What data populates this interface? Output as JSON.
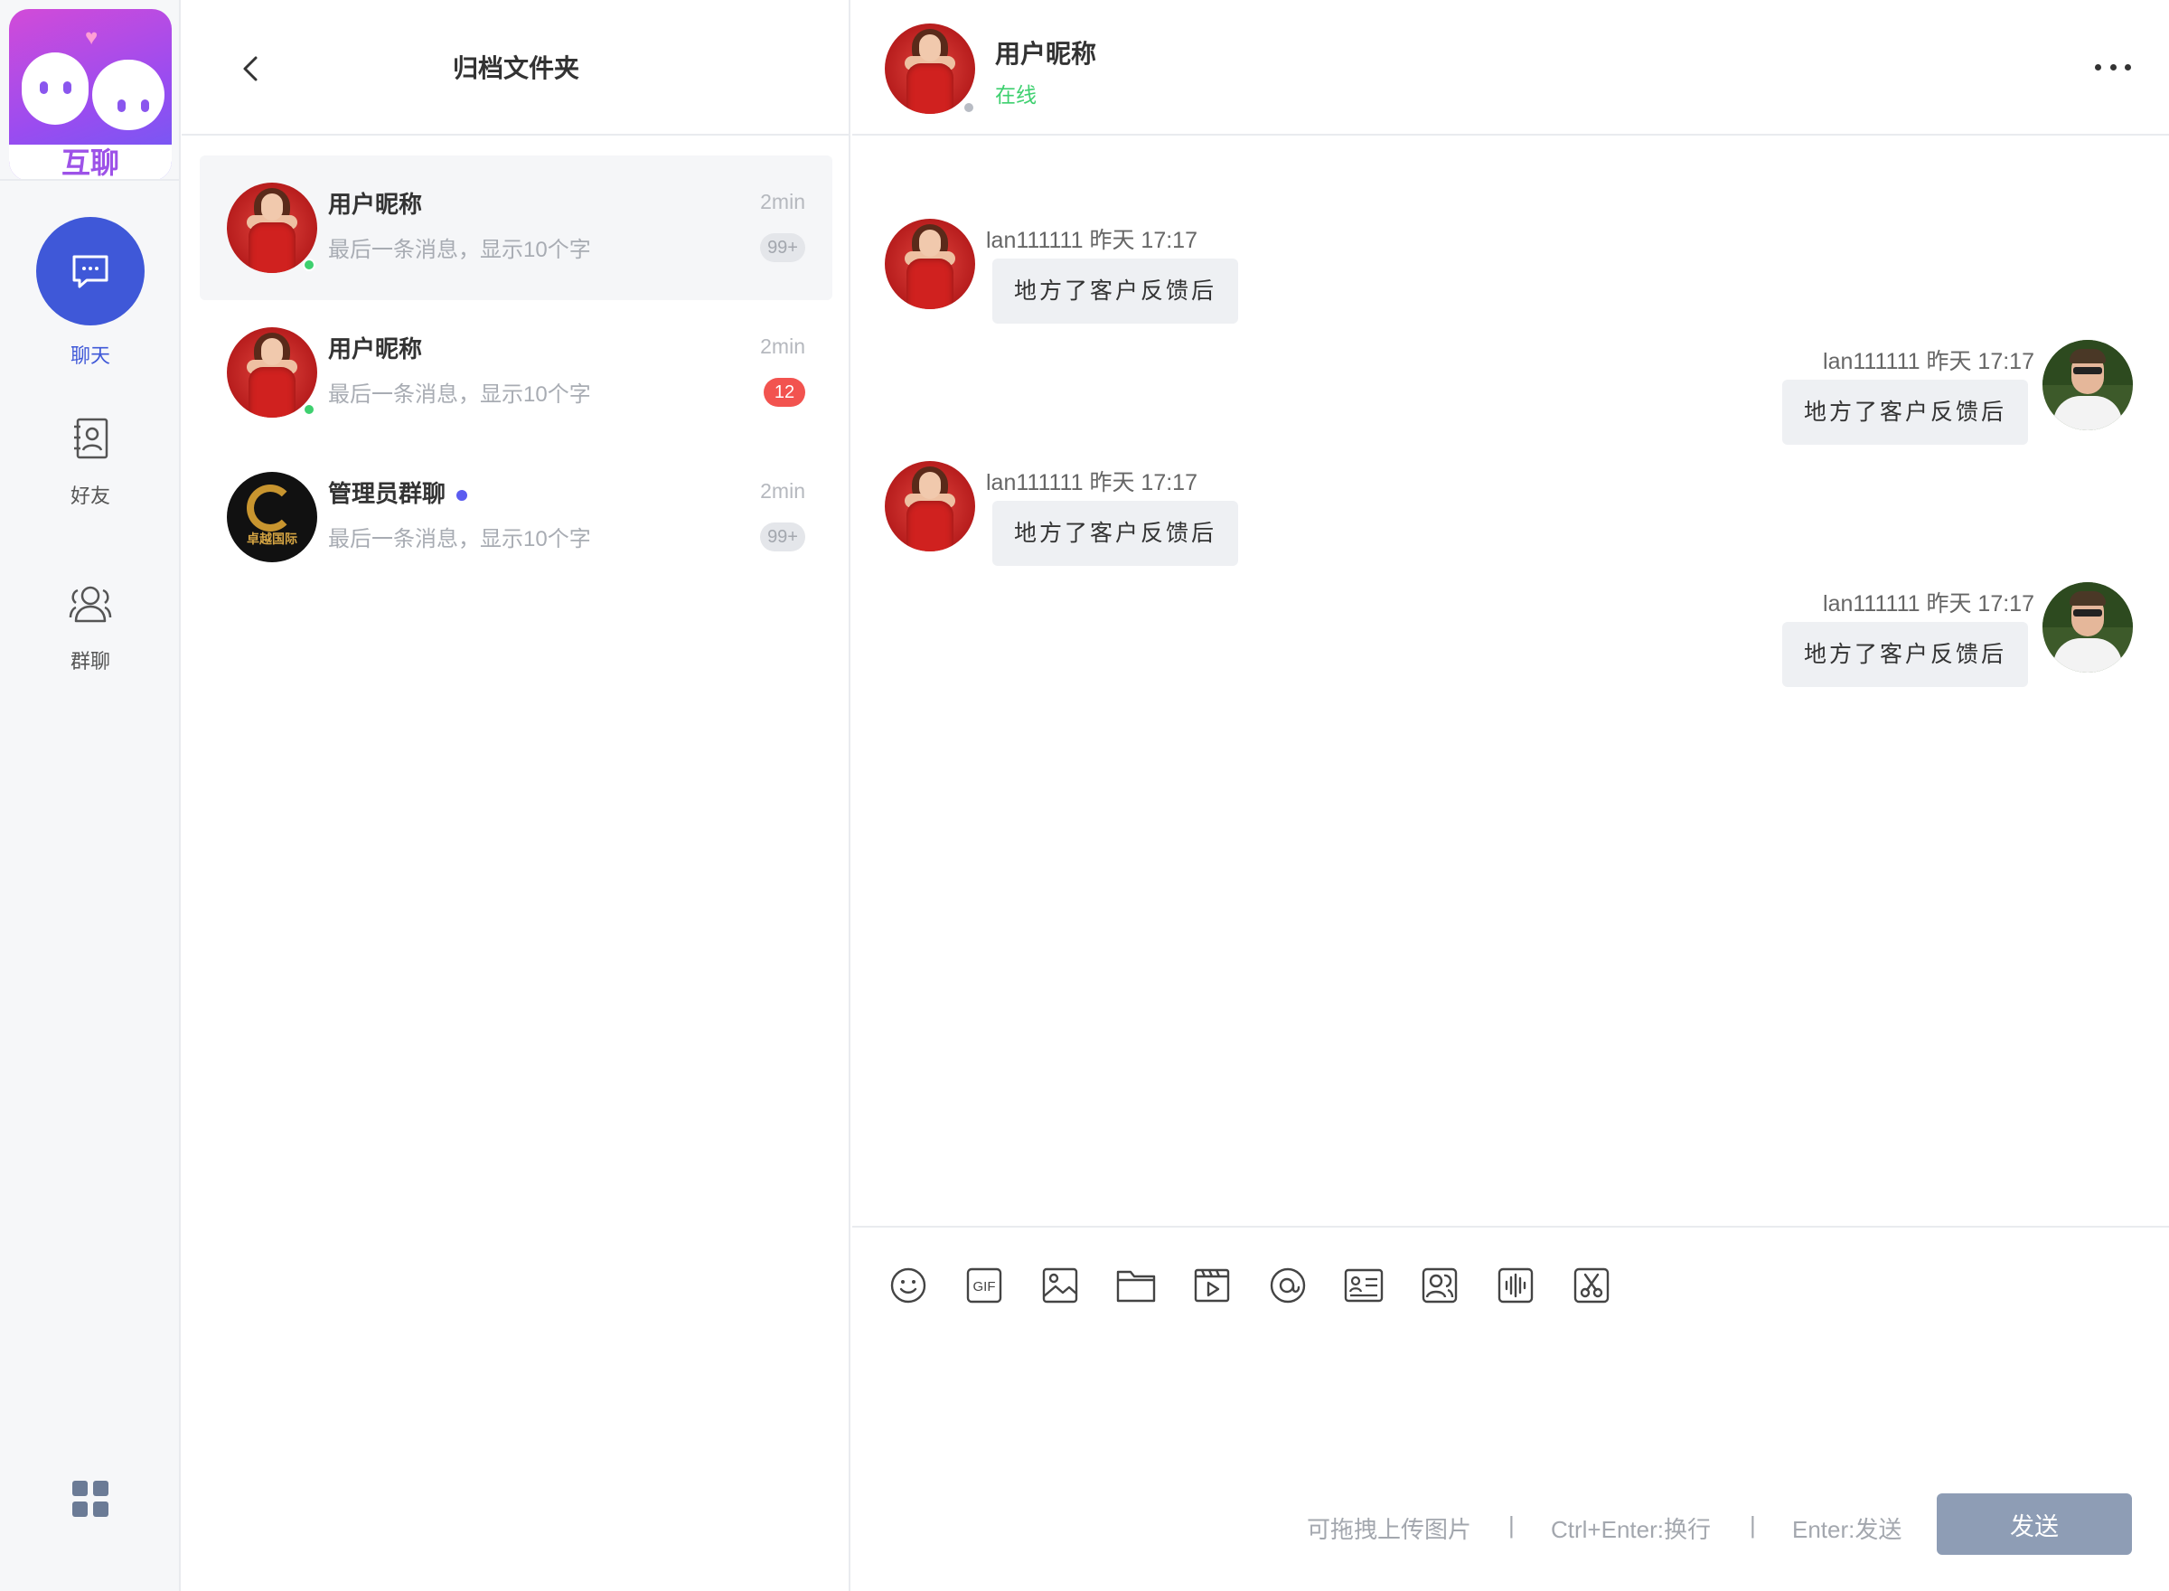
{
  "app": {
    "logo_text": "互聊"
  },
  "nav": {
    "items": [
      {
        "label": "聊天",
        "icon": "chat-bubble-icon",
        "active": true
      },
      {
        "label": "好友",
        "icon": "contacts-icon",
        "active": false
      },
      {
        "label": "群聊",
        "icon": "group-icon",
        "active": false
      }
    ],
    "apps_icon": "apps-grid-icon"
  },
  "list": {
    "title": "归档文件夹",
    "conversations": [
      {
        "name": "用户昵称",
        "preview": "最后一条消息，显示10个字",
        "time": "2min",
        "badge": "99+",
        "badge_color": "#e4e6ea",
        "online": true,
        "avatar": "woman-red-dress"
      },
      {
        "name": "用户昵称",
        "preview": "最后一条消息，显示10个字",
        "time": "2min",
        "badge": "12",
        "badge_color": "#f2534f",
        "online": true,
        "avatar": "woman-red-dress"
      },
      {
        "name": "管理员群聊",
        "preview": "最后一条消息，显示10个字",
        "time": "2min",
        "badge": "99+",
        "badge_color": "#e4e6ea",
        "online": false,
        "avatar": "group-logo",
        "avatar_text": "卓越国际"
      }
    ]
  },
  "chat": {
    "name": "用户昵称",
    "status": "在线",
    "status_color": "#3ed06f",
    "messages": [
      {
        "side": "left",
        "sender": "lan111111",
        "time": "昨天 17:17",
        "text": "地方了客户反馈后"
      },
      {
        "side": "right",
        "sender": "lan111111",
        "time": "昨天 17:17",
        "text": "地方了客户反馈后"
      },
      {
        "side": "left",
        "sender": "lan111111",
        "time": "昨天 17:17",
        "text": "地方了客户反馈后"
      },
      {
        "side": "right",
        "sender": "lan111111",
        "time": "昨天 17:17",
        "text": "地方了客户反馈后"
      }
    ]
  },
  "composer": {
    "tools": [
      "emoji-icon",
      "gif-icon",
      "image-icon",
      "folder-icon",
      "video-icon",
      "mention-icon",
      "contact-card-icon",
      "contacts-icon",
      "voice-icon",
      "screenshot-icon"
    ],
    "gif_label": "GIF",
    "hint_drag": "可拖拽上传图片",
    "separator": "|",
    "hint_newline": "Ctrl+Enter:换行",
    "hint_send": "Enter:发送",
    "send_label": "发送"
  },
  "colors": {
    "accent": "#3f58d8",
    "online": "#3ed06f",
    "badge_red": "#f2534f",
    "send_button": "#8e9db5"
  }
}
